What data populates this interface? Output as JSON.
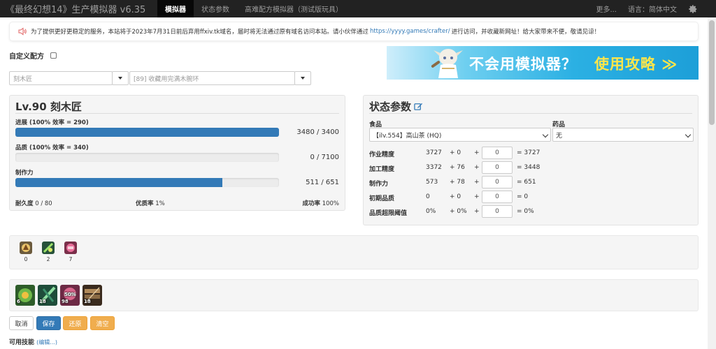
{
  "nav": {
    "brand": "《最终幻想14》生产模拟器 v6.35",
    "items": [
      "模拟器",
      "状态参数",
      "高难配方模拟器（测试版玩具）"
    ],
    "more": "更多...",
    "language": "语言：简体中文"
  },
  "notice": {
    "text_before": "为了提供更好更稳定的服务，本站将于2023年7月31日前后弃用ffxiv.tk域名，届时将无法通过原有域名访问本站。请小伙伴通过",
    "link": "https://yyyy.games/crafter/",
    "text_after": "进行访问，并收藏新网址！给大家带来不便，敬请见谅！"
  },
  "custom_recipe_label": "自定义配方",
  "job_select": "刻木匠",
  "recipe_select": "[89] 收藏用完满木腕环",
  "banner": {
    "text_main": "不会用模拟器？",
    "text_accent": "使用攻略 ≫"
  },
  "craft": {
    "title": "Lv.90 刻木匠",
    "progress": {
      "label": "进展 (100% 效率 = 290)",
      "value": "3480 / 3400",
      "fill": 1.0
    },
    "quality": {
      "label": "品质 (100% 效率 = 340)",
      "value": "0 / 7100",
      "fill": 0.0
    },
    "cp": {
      "label": "制作力",
      "value": "511 / 651",
      "fill": 0.785
    },
    "durability_label": "耐久度",
    "durability_value": "0 / 80",
    "hq_label": "优质率",
    "hq_value": "1%",
    "success_label": "成功率",
    "success_value": "100%"
  },
  "stats": {
    "title": "状态参数",
    "food_label": "食品",
    "food_value": "【ilv.554】高山茶 (HQ)",
    "medicine_label": "药品",
    "medicine_value": "无",
    "rows": [
      {
        "label": "作业精度",
        "base": "3727",
        "bonus": "+ 0",
        "plus": "+",
        "input": "0",
        "total": "= 3727"
      },
      {
        "label": "加工精度",
        "base": "3372",
        "bonus": "+ 76",
        "plus": "+",
        "input": "0",
        "total": "= 3448"
      },
      {
        "label": "制作力",
        "base": "573",
        "bonus": "+ 78",
        "plus": "+",
        "input": "0",
        "total": "= 651"
      },
      {
        "label": "初期品质",
        "base": "0",
        "bonus": "+ 0",
        "plus": "+",
        "input": "0",
        "total": "= 0"
      },
      {
        "label": "品质超限阈值",
        "base": "0%",
        "bonus": "+ 0%",
        "plus": "+",
        "input": "0",
        "total": "= 0%"
      }
    ]
  },
  "buffs": [
    {
      "icon": "veneration-buff-icon",
      "count": "0"
    },
    {
      "icon": "waste-not-buff-icon",
      "count": "2"
    },
    {
      "icon": "manipulation-buff-icon",
      "count": "7"
    }
  ],
  "rotation": [
    {
      "icon": "muscle-memory-skill-icon",
      "badge": "6"
    },
    {
      "icon": "manipulation-skill-icon",
      "badge": "18"
    },
    {
      "icon": "veneration-skill-icon",
      "badge": "98",
      "badge2": "50%"
    },
    {
      "icon": "groundwork-skill-icon",
      "badge": "18"
    }
  ],
  "buttons": {
    "cancel": "取消",
    "save": "保存",
    "restore": "还原",
    "clear": "清空"
  },
  "available_skills_label": "可用技能",
  "edit_link": "(编辑...)",
  "colors": {
    "primary": "#337ab7",
    "warning": "#f0ad4e",
    "navbar": "#222222",
    "banner_accent": "#ffe64a"
  }
}
